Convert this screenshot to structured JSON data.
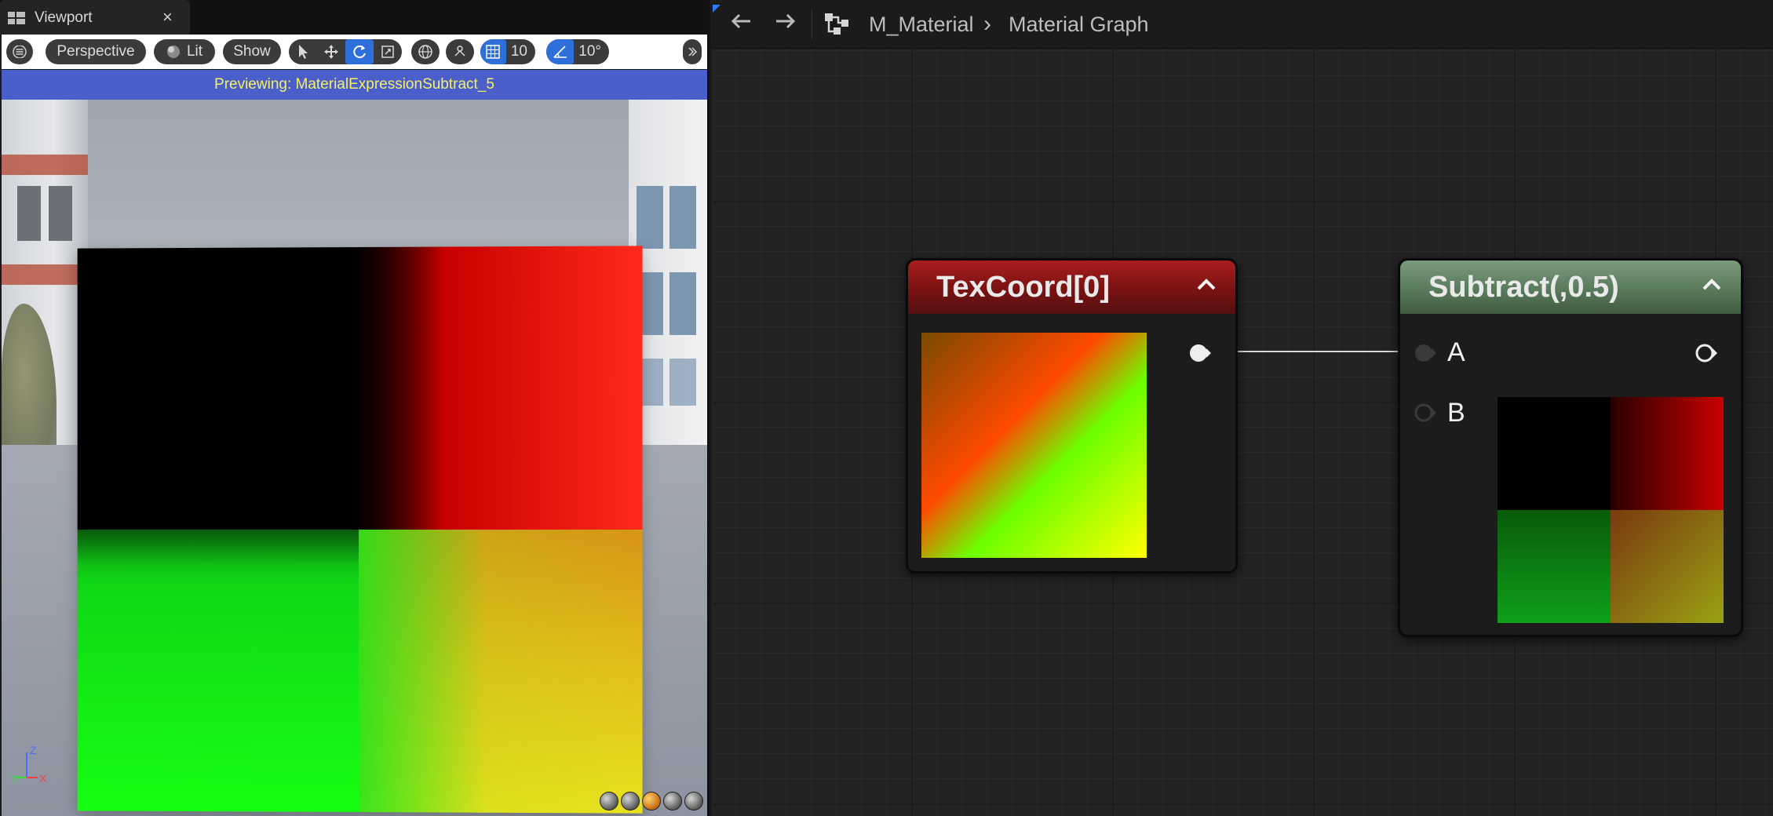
{
  "viewport": {
    "tab_label": "Viewport",
    "close_glyph": "×",
    "toolbar": {
      "perspective_label": "Perspective",
      "lit_label": "Lit",
      "show_label": "Show",
      "grid_snap_value": "10",
      "rotation_snap_value": "10°"
    },
    "banner_text": "Previewing: MaterialExpressionSubtract_5",
    "axes": {
      "z": "Z",
      "y": "Y",
      "x": "X"
    }
  },
  "graph": {
    "breadcrumb": {
      "asset": "M_Material",
      "separator": "›",
      "page": "Material Graph"
    },
    "nodes": {
      "texcoord": {
        "title": "TexCoord[0]",
        "header_color": "#8b1717"
      },
      "subtract": {
        "title": "Subtract(,0.5)",
        "header_color": "#5f7f61",
        "pin_a": "A",
        "pin_b": "B"
      }
    }
  },
  "colors": {
    "banner_bg": "#4a5fc9",
    "banner_text": "#f6f068",
    "accent_blue": "#2b7bff",
    "toolbar_active": "#2f6fd9"
  },
  "icons": [
    "hamburger-menu-icon",
    "lit-sphere-icon",
    "select-arrow-icon",
    "move-icon",
    "rotate-icon",
    "scale-icon",
    "world-local-icon",
    "surface-snap-icon",
    "grid-snap-icon",
    "angle-snap-icon",
    "more-chevron-icon",
    "back-arrow-icon",
    "forward-arrow-icon",
    "graph-hierarchy-icon",
    "collapse-chevron-icon"
  ]
}
